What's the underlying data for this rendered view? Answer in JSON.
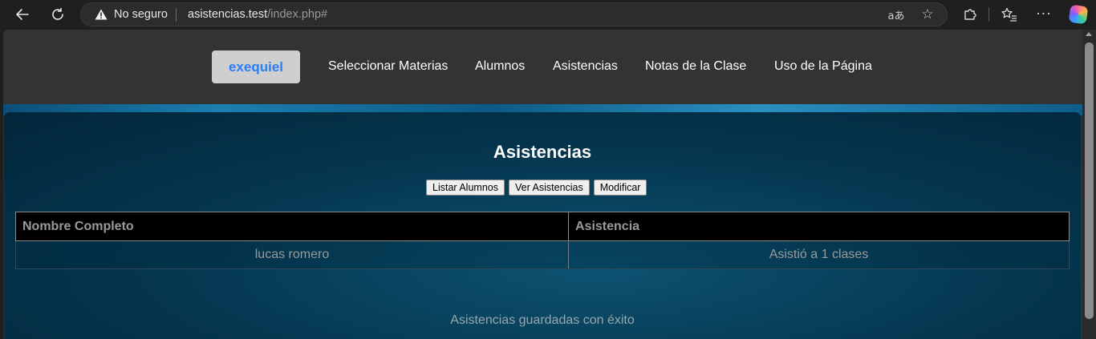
{
  "browser": {
    "security_label": "No seguro",
    "url_host": "asistencias.test",
    "url_path": "/index.php#",
    "icons": {
      "back": "back-arrow-icon",
      "reload": "reload-icon",
      "warning": "warning-triangle-icon",
      "translate": "translate-icon",
      "favorite": "star-icon",
      "extensions": "puzzle-icon",
      "favorites": "favorites-list-icon",
      "menu": "more-horizontal-icon",
      "copilot": "copilot-icon"
    }
  },
  "nav": {
    "user": "exequiel",
    "links": [
      "Seleccionar Materias",
      "Alumnos",
      "Asistencias",
      "Notas de la Clase",
      "Uso de la Página"
    ]
  },
  "main": {
    "title": "Asistencias",
    "buttons": [
      "Listar Alumnos",
      "Ver Asistencias",
      "Modificar"
    ],
    "table": {
      "headers": [
        "Nombre Completo",
        "Asistencia"
      ],
      "rows": [
        [
          "lucas romero",
          "Asistió a 1 clases"
        ]
      ]
    },
    "status_message": "Asistencias guardadas con éxito"
  },
  "colors": {
    "user_text": "#2b7ef5",
    "panel": "#053750",
    "header_bg": "#000000"
  }
}
